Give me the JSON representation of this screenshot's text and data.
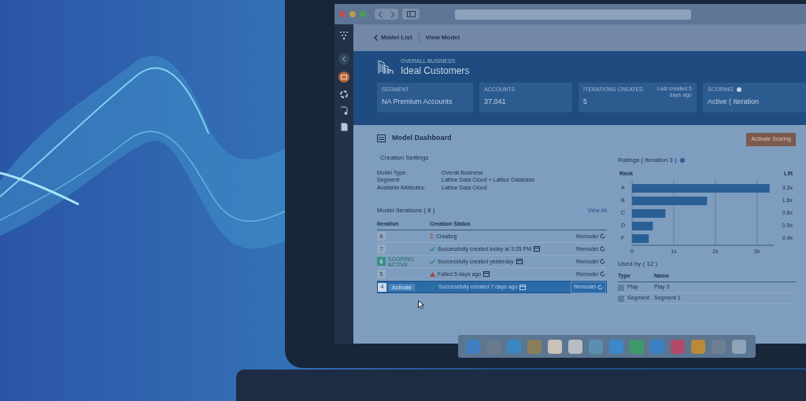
{
  "breadcrumb": {
    "back": "Model List",
    "current": "View Model"
  },
  "model": {
    "category": "OVERALL BUSINESS",
    "name": "Ideal Customers"
  },
  "stats": [
    {
      "label": "SEGMENT",
      "value": "NA Premium Accounts"
    },
    {
      "label": "ACCOUNTS",
      "value": "37,041"
    },
    {
      "label": "ITERATIONS CREATED",
      "value": "5",
      "note": "Last created 5 days ago"
    },
    {
      "label": "SCORING",
      "value": "Active ( Iteration",
      "info": true
    }
  ],
  "dashboard": {
    "title": "Model Dashboard",
    "action": "Activate Scoring"
  },
  "settings": {
    "title": "Creation Settings",
    "rows": [
      {
        "label": "Model Type:",
        "value": "Overall Business"
      },
      {
        "label": "Segment:",
        "value": "Lattice Data Cloud + Lattice Database"
      },
      {
        "label": "Available Attributes:",
        "value": "Lattice Data Cloud"
      }
    ]
  },
  "iterations": {
    "title": "Model Iterations ( 8 )",
    "link": "View All",
    "columns": [
      "Iteration",
      "Creation Status"
    ],
    "rows": [
      {
        "number": "8",
        "kind": "creating",
        "text": "Creating",
        "calendar": false,
        "action": "Remodel",
        "selected": false
      },
      {
        "number": "7",
        "kind": "success",
        "text": "Successfully created today at 3:25 PM",
        "calendar": true,
        "action": "Remodel",
        "selected": false
      },
      {
        "number": "6",
        "badge": "SCORING ACTIVE",
        "kind": "success",
        "text": "Successfully created yesterday",
        "calendar": true,
        "action": "Remodel",
        "selected": false
      },
      {
        "number": "5",
        "kind": "failed",
        "text": "Failed 5 days ago",
        "calendar": true,
        "action": "Remodel",
        "selected": false
      },
      {
        "number": "4",
        "button": "Activate",
        "kind": "success",
        "text": "Successfully created 7 days ago",
        "calendar": true,
        "action": "Remodel",
        "selected": true
      }
    ]
  },
  "ratings": {
    "title": "Ratings ( Iteration 3 )",
    "rank_label": "Rank",
    "lift_label": "Lift",
    "chart_data": {
      "type": "bar",
      "orientation": "horizontal",
      "categories": [
        "A",
        "B",
        "C",
        "D",
        "F"
      ],
      "values": [
        3.3,
        1.8,
        0.8,
        0.5,
        0.4
      ],
      "xlim": [
        0,
        3.4
      ],
      "grid": true,
      "xticks": [
        {
          "value": 0,
          "label": "0"
        },
        {
          "value": 1,
          "label": "1x"
        },
        {
          "value": 2,
          "label": "2x"
        },
        {
          "value": 3,
          "label": "3x"
        }
      ],
      "value_labels": [
        "3.3x",
        "1.8x",
        "0.8x",
        "0.5x",
        "0.4x"
      ]
    }
  },
  "used_by": {
    "title": "Used by ( 12 )",
    "columns": [
      "Type",
      "Name"
    ],
    "rows": [
      {
        "type": "Play",
        "name": "Play 3"
      },
      {
        "type": "Segment",
        "name": "Segment 1"
      }
    ]
  }
}
